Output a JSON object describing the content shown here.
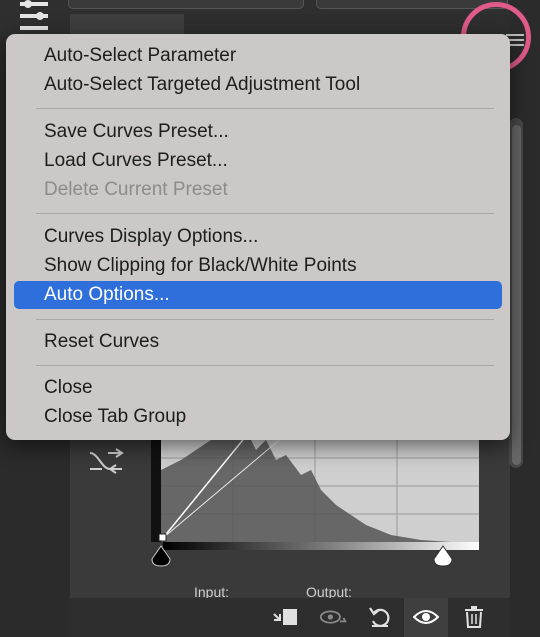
{
  "panel": {
    "input_label": "Input:",
    "output_label": "Output:"
  },
  "menu": {
    "groups": [
      [
        {
          "label": "Auto-Select Parameter",
          "enabled": true
        },
        {
          "label": "Auto-Select Targeted Adjustment Tool",
          "enabled": true
        }
      ],
      [
        {
          "label": "Save Curves Preset...",
          "enabled": true
        },
        {
          "label": "Load Curves Preset...",
          "enabled": true
        },
        {
          "label": "Delete Current Preset",
          "enabled": false
        }
      ],
      [
        {
          "label": "Curves Display Options...",
          "enabled": true
        },
        {
          "label": "Show Clipping for Black/White Points",
          "enabled": true
        },
        {
          "label": "Auto Options...",
          "enabled": true,
          "selected": true
        }
      ],
      [
        {
          "label": "Reset Curves",
          "enabled": true
        }
      ],
      [
        {
          "label": "Close",
          "enabled": true
        },
        {
          "label": "Close Tab Group",
          "enabled": true
        }
      ]
    ]
  },
  "icons": {
    "panel_menu": "hamburger-icon",
    "clip_to_layer": "clip-to-layer-icon",
    "view_previous": "view-previous-icon",
    "reset": "reset-icon",
    "visibility": "eye-icon",
    "delete": "trash-icon",
    "curve_tool": "on-image-adjust-icon"
  },
  "colors": {
    "menu_bg": "#ccc8c8",
    "selection": "#2f6fdb",
    "annotation_circle": "#e05a8a",
    "panel_bg": "#3a3a3a"
  }
}
